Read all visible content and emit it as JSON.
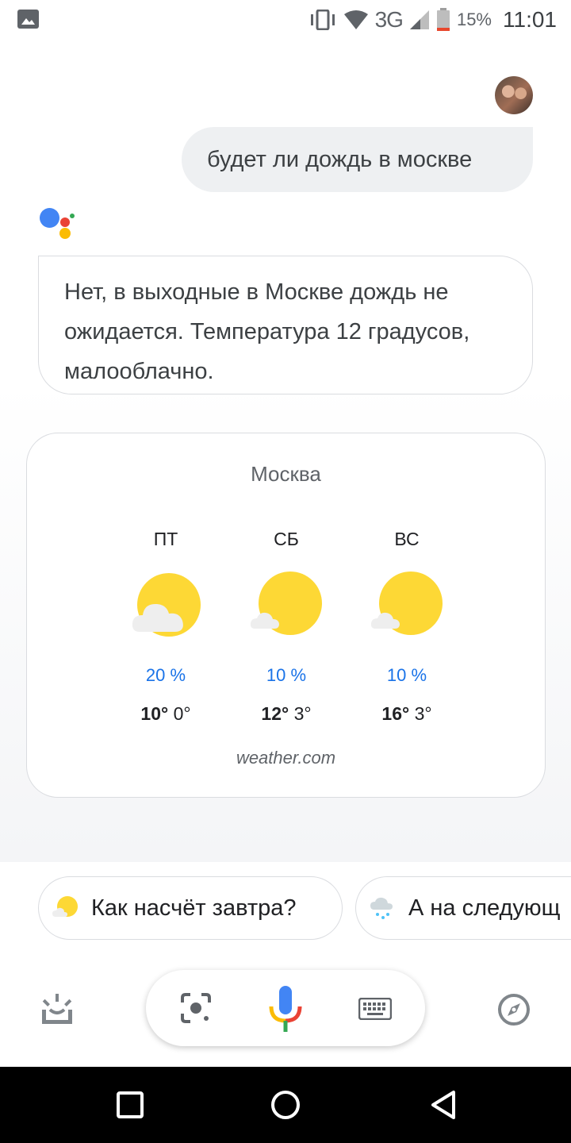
{
  "status_bar": {
    "network": "3G",
    "battery_percent": "15%",
    "time": "11:01"
  },
  "conversation": {
    "user_query": "будет ли дождь в москве",
    "assistant_response": "Нет, в выходные в Москве дождь не ожидается. Температура 12 градусов, малооблачно."
  },
  "weather": {
    "city": "Москва",
    "days": [
      {
        "name": "ПТ",
        "icon": "mostly-cloudy-icon",
        "precip": "20 %",
        "high": "10°",
        "low": "0°"
      },
      {
        "name": "СБ",
        "icon": "partly-sunny-icon",
        "precip": "10 %",
        "high": "12°",
        "low": "3°"
      },
      {
        "name": "ВС",
        "icon": "partly-sunny-icon",
        "precip": "10 %",
        "high": "16°",
        "low": "3°"
      }
    ],
    "source": "weather.com"
  },
  "suggestions": [
    {
      "label": "Как насчёт завтра?",
      "icon": "partly-sunny-icon"
    },
    {
      "label": "А на следующ",
      "icon": "rain-icon"
    }
  ],
  "bottom_bar": {
    "left_icon": "updates-icon",
    "center_icons": [
      "lens-icon",
      "mic-icon",
      "keyboard-icon"
    ],
    "right_icon": "compass-icon"
  },
  "colors": {
    "google_blue": "#4285F4",
    "google_red": "#EA4335",
    "google_yellow": "#FBBC04",
    "google_green": "#34A853",
    "precip_blue": "#1a73e8",
    "sun": "#FDD835"
  }
}
